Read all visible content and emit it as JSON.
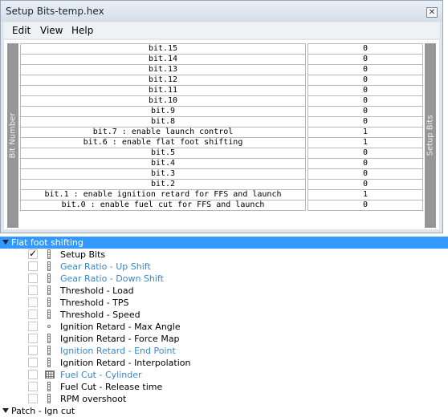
{
  "window": {
    "title": "Setup Bits-temp.hex",
    "close_glyph": "✕"
  },
  "menu": {
    "items": [
      "Edit",
      "View",
      "Help"
    ]
  },
  "table": {
    "left_label": "Bit Number",
    "right_label": "Setup Bits",
    "rows": [
      {
        "name": "bit.15",
        "value": "0"
      },
      {
        "name": "bit.14",
        "value": "0"
      },
      {
        "name": "bit.13",
        "value": "0"
      },
      {
        "name": "bit.12",
        "value": "0"
      },
      {
        "name": "bit.11",
        "value": "0"
      },
      {
        "name": "bit.10",
        "value": "0"
      },
      {
        "name": "bit.9",
        "value": "0"
      },
      {
        "name": "bit.8",
        "value": "0"
      },
      {
        "name": "bit.7 : enable launch control",
        "value": "1"
      },
      {
        "name": "bit.6 : enable flat foot shifting",
        "value": "1"
      },
      {
        "name": "bit.5",
        "value": "0"
      },
      {
        "name": "bit.4",
        "value": "0"
      },
      {
        "name": "bit.3",
        "value": "0"
      },
      {
        "name": "bit.2",
        "value": "0"
      },
      {
        "name": "bit.1 : enable ignition retard for FFS and launch",
        "value": "1"
      },
      {
        "name": "bit.0 : enable fuel cut for FFS and launch",
        "value": "0"
      }
    ]
  },
  "tree": {
    "group1": "Flat foot shifting",
    "items": [
      {
        "label": "Setup Bits",
        "checked": true,
        "icon": "bar-icon",
        "color": "black"
      },
      {
        "label": "Gear Ratio - Up Shift",
        "checked": false,
        "icon": "bar-icon",
        "color": "blue"
      },
      {
        "label": "Gear Ratio - Down Shift",
        "checked": false,
        "icon": "bar-icon",
        "color": "blue"
      },
      {
        "label": "Threshold - Load",
        "checked": false,
        "icon": "bar-icon",
        "color": "black"
      },
      {
        "label": "Threshold - TPS",
        "checked": false,
        "icon": "bar-icon",
        "color": "black"
      },
      {
        "label": "Threshold - Speed",
        "checked": false,
        "icon": "bar-icon",
        "color": "black"
      },
      {
        "label": "Ignition Retard - Max Angle",
        "checked": false,
        "icon": "dot-icon",
        "color": "black"
      },
      {
        "label": "Ignition Retard - Force Map",
        "checked": false,
        "icon": "bar-icon",
        "color": "black"
      },
      {
        "label": "Ignition Retard - End Point",
        "checked": false,
        "icon": "bar-icon",
        "color": "blue"
      },
      {
        "label": "Ignition Retard - Interpolation",
        "checked": false,
        "icon": "bar-icon",
        "color": "black"
      },
      {
        "label": "Fuel Cut - Cylinder",
        "checked": false,
        "icon": "grid-icon",
        "color": "blue"
      },
      {
        "label": "Fuel Cut - Release time",
        "checked": false,
        "icon": "bar-icon",
        "color": "black"
      },
      {
        "label": "RPM overshoot",
        "checked": false,
        "icon": "bar-icon",
        "color": "black"
      }
    ],
    "group2": "Patch - Ign cut"
  },
  "colors": {
    "selection": "#3399ff",
    "link_blue": "#3a86c8",
    "bit_label_bg": "#969696"
  }
}
